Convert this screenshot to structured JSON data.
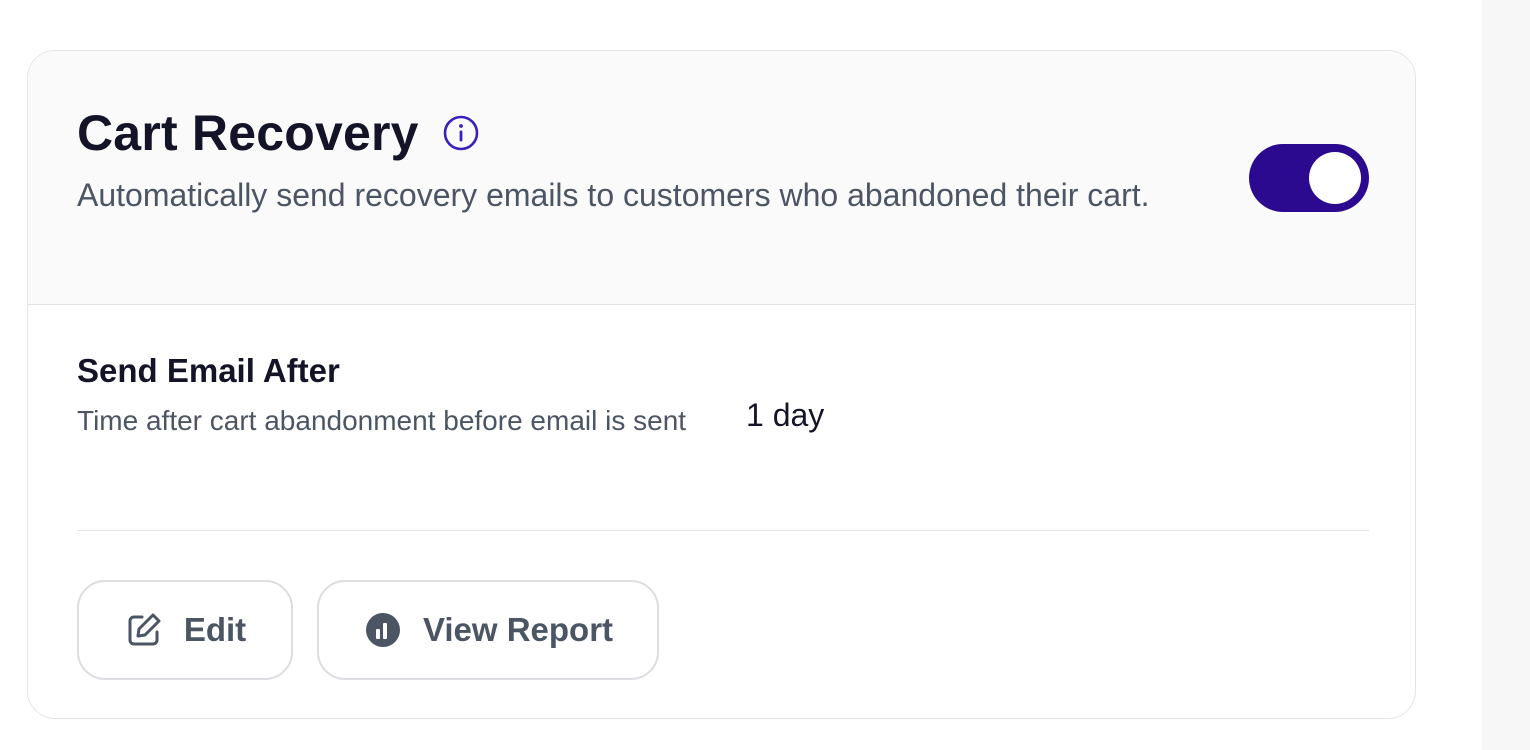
{
  "card": {
    "title": "Cart Recovery",
    "description": "Automatically send recovery emails to customers who abandoned their cart.",
    "enabled": true,
    "accent_color": "#2b0a8f",
    "info_icon": "info-icon"
  },
  "setting": {
    "label": "Send Email After",
    "description": "Time after cart abandonment before email is sent",
    "value": "1 day"
  },
  "actions": {
    "edit_label": "Edit",
    "edit_icon": "pencil-square-icon",
    "report_label": "View Report",
    "report_icon": "chart-pie-icon"
  }
}
